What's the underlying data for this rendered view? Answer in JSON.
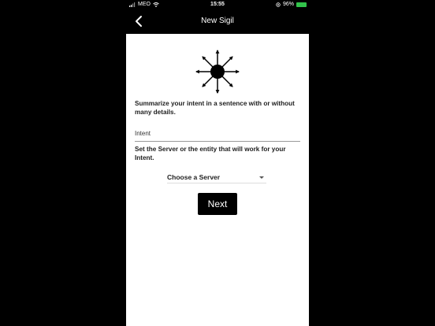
{
  "status_bar": {
    "carrier": "MEO",
    "time": "15:55",
    "battery_percent": "96%",
    "battery_icon": "battery-icon",
    "signal_icon": "signal-bars-icon",
    "wifi_icon": "wifi-icon",
    "location_icon": "location-icon"
  },
  "nav": {
    "title": "New Sigil",
    "back_icon": "chevron-left-icon"
  },
  "form": {
    "sigil_icon": "chaos-star-icon",
    "intent_prompt": "Summarize your intent in a sentence with or without many details.",
    "intent_placeholder": "Intent",
    "intent_value": "",
    "server_prompt": "Set the Server or the entity that will work for your Intent.",
    "server_select_label": "Choose a Server",
    "next_label": "Next"
  },
  "colors": {
    "background": "#000000",
    "content_background": "#ffffff",
    "battery_fill": "#32c24b",
    "button_background": "#000000"
  }
}
